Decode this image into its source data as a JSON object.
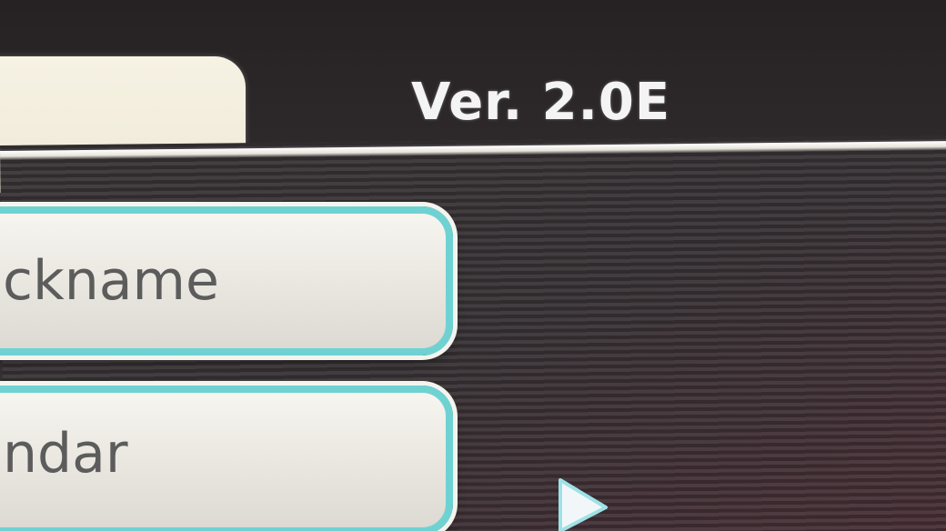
{
  "header": {
    "version_label": "Ver. 2.0E"
  },
  "menu": {
    "items": [
      {
        "label": "ckname"
      },
      {
        "label": "ndar"
      }
    ]
  },
  "icons": {
    "next": "right-arrow-icon"
  },
  "colors": {
    "button_border": "#6fd2d2",
    "button_fill": "#f0ede6",
    "version_text": "#f4f4f4",
    "tab_fill": "#f6f2e4",
    "background": "#2b2728"
  }
}
